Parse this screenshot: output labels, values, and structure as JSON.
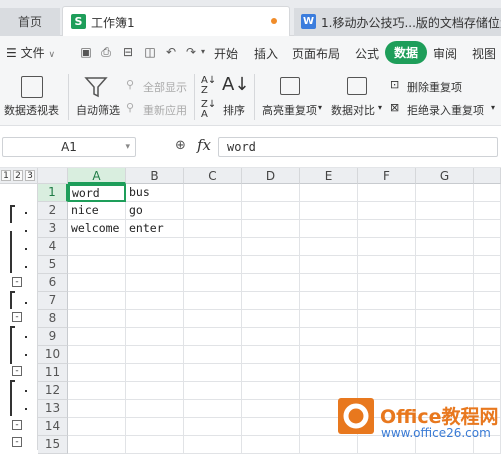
{
  "tabs": {
    "home": "首页",
    "active_doc": "工作簿1",
    "other_doc": "1.移动办公技巧...版的文档存储位置"
  },
  "menu": {
    "file": "文件",
    "tabs": [
      "开始",
      "插入",
      "页面布局",
      "公式",
      "数据",
      "审阅",
      "视图"
    ],
    "active": "数据"
  },
  "ribbon": {
    "pivot": "数据透视表",
    "autofilter": "自动筛选",
    "show_all": "全部显示",
    "reapply": "重新应用",
    "sort": "排序",
    "highlight_dup": "高亮重复项",
    "compare": "数据对比",
    "remove_dup": "删除重复项",
    "reject_dup": "拒绝录入重复项"
  },
  "formula_bar": {
    "cell_ref": "A1",
    "fx": "fx",
    "content": "word"
  },
  "outline": {
    "levels": [
      "1",
      "2",
      "3"
    ]
  },
  "sheet": {
    "columns": [
      "A",
      "B",
      "C",
      "D",
      "E",
      "F",
      "G"
    ],
    "rows": [
      "1",
      "2",
      "3",
      "4",
      "5",
      "6",
      "7",
      "8",
      "9",
      "10",
      "11",
      "12",
      "13",
      "14",
      "15"
    ],
    "cells": {
      "A1": "word",
      "B1": "bus",
      "A2": "nice",
      "B2": "go",
      "A3": "welcome",
      "B3": "enter"
    },
    "active_cell": "A1"
  },
  "watermark": {
    "brand": "Office教程网",
    "url": "www.office26.com"
  },
  "colors": {
    "accent": "#1e9e5a",
    "watermark_orange": "#e8781e",
    "watermark_blue": "#3a7bd5"
  }
}
